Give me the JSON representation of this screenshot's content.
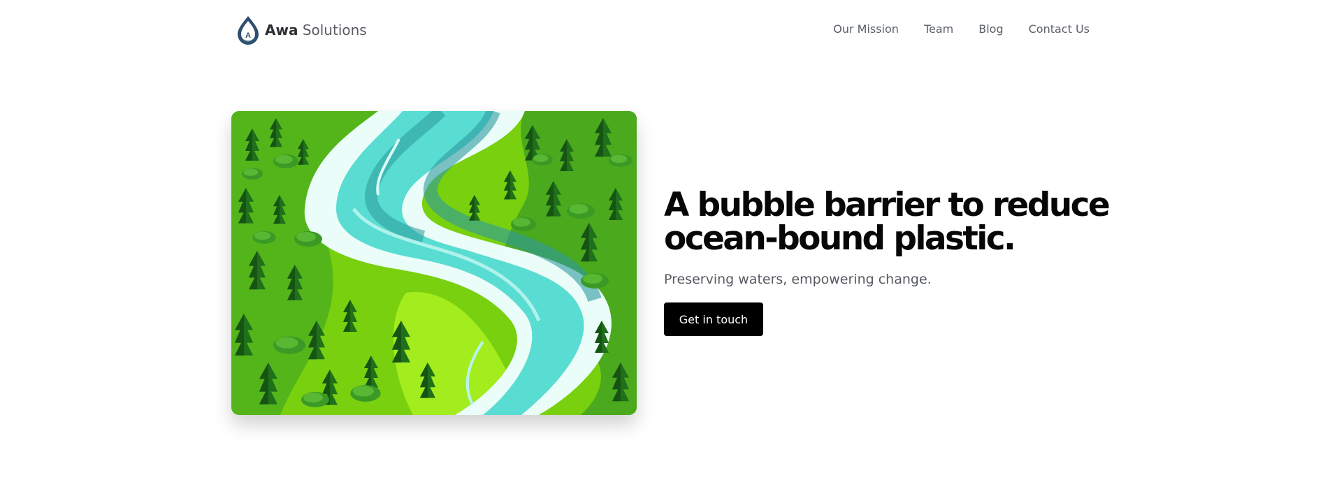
{
  "brand": {
    "name_strong": "Awa",
    "name_light": "Solutions",
    "logo_icon": "water-drop-letter-a-icon",
    "logo_letter": "A",
    "colors": {
      "drop": "#2d4f6d",
      "drop_light": "#5f8fb1"
    }
  },
  "nav": {
    "items": [
      {
        "label": "Our Mission"
      },
      {
        "label": "Team"
      },
      {
        "label": "Blog"
      },
      {
        "label": "Contact Us"
      }
    ]
  },
  "hero": {
    "image": "illustration-river-through-forest",
    "title": "A bubble barrier to reduce ocean-bound plastic.",
    "subtitle": "Preserving waters, empowering change.",
    "cta_label": "Get in touch",
    "colors": {
      "button_bg": "#000000",
      "button_text": "#ffffff",
      "river": "#59dcd2",
      "river_bank": "#eafdf8",
      "grass": "#79d212",
      "forest": "#1f7a1f"
    }
  }
}
